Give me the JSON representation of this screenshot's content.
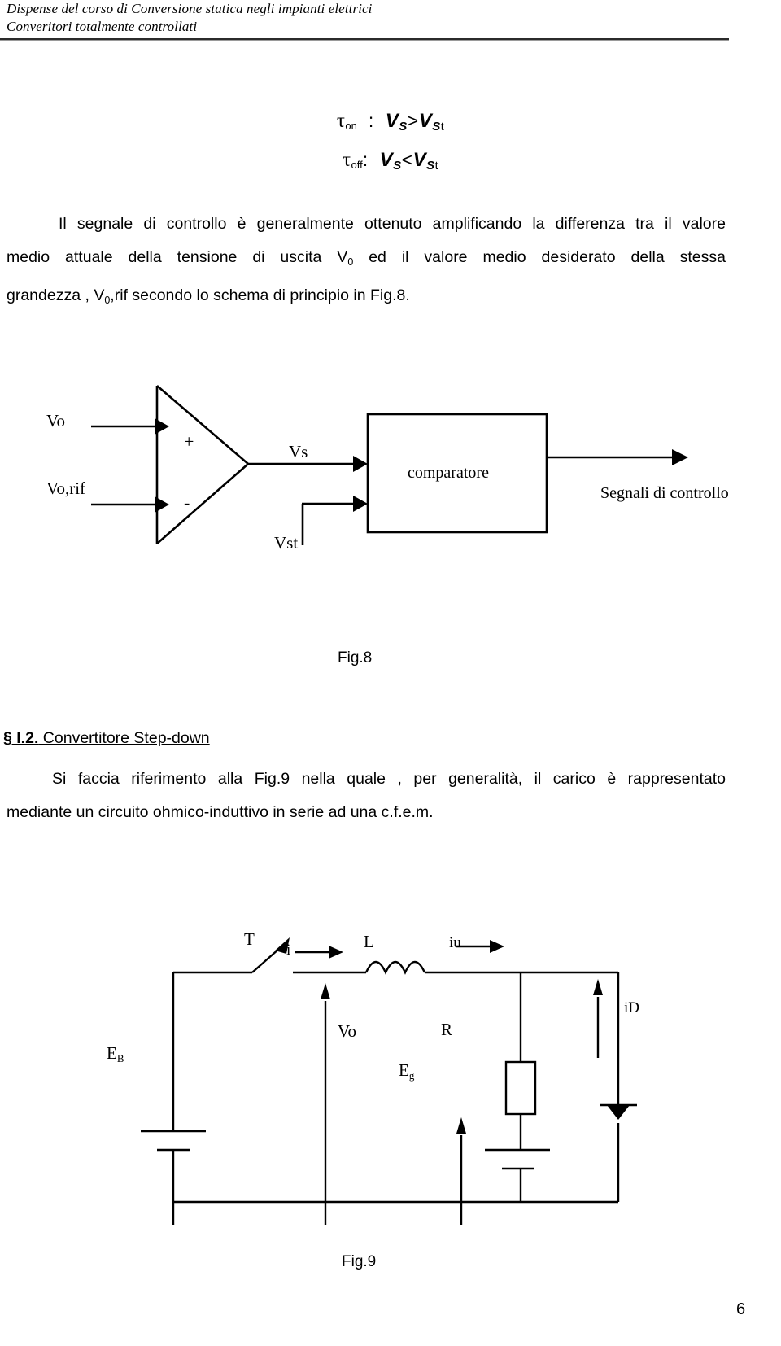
{
  "header": {
    "line1": "Dispense del corso di Conversione statica negli impianti elettrici",
    "line2": "Converitori totalmente controllati"
  },
  "formulas": {
    "tau_on": {
      "symbol": "τ",
      "subscript": "on",
      "colon": ":",
      "lhs": "V",
      "lhs_sub": "S",
      "relation": ">",
      "rhs": "V",
      "rhs_sub": "S",
      "rhs_sub2": "t"
    },
    "tau_off": {
      "symbol": "τ",
      "subscript": "off",
      "colon": ":",
      "lhs": "V",
      "lhs_sub": "S",
      "relation": "<",
      "rhs": "V",
      "rhs_sub": "S",
      "rhs_sub2": "t"
    }
  },
  "paragraphs": {
    "intro": {
      "line1": "Il segnale di controllo è generalmente ottenuto amplificando la differenza tra il valore",
      "line2_a": "medio   attuale della tensione di uscita V",
      "line2_sub": "0",
      "line2_b": " ed il valore medio desiderato della stessa",
      "line3_a": "grandezza ,  V",
      "line3_sub": "0",
      "line3_b": ",rif  secondo lo schema di principio in Fig.8."
    },
    "stepdown": {
      "line1": "Si faccia riferimento   alla Fig.9 nella quale ,  per generalità, il carico è rappresentato",
      "line2": "mediante un circuito ohmico-induttivo in serie ad una c.f.e.m."
    }
  },
  "section": {
    "number": "§ I.2.",
    "title": " Convertitore Step-down"
  },
  "fig8": {
    "caption": "Fig.8",
    "labels": {
      "vo": "Vo",
      "vorif": "Vo,rif",
      "vs": "Vs",
      "vst": "Vst",
      "comparatore": "comparatore",
      "segnali": "Segnali di controllo",
      "plus": "+",
      "minus": "-"
    }
  },
  "fig9": {
    "caption": "Fig.9",
    "labels": {
      "T": "T",
      "i": "i",
      "L": "L",
      "iu": "iu",
      "iD": "iD",
      "Vo": "Vo",
      "R": "R",
      "EB": "E",
      "EB_sub": "B",
      "Eg": "E",
      "Eg_sub": "g"
    }
  },
  "page_number": "6",
  "colors": {
    "ink": "#000000",
    "background": "#ffffff",
    "rule": "#2b2b2b"
  }
}
